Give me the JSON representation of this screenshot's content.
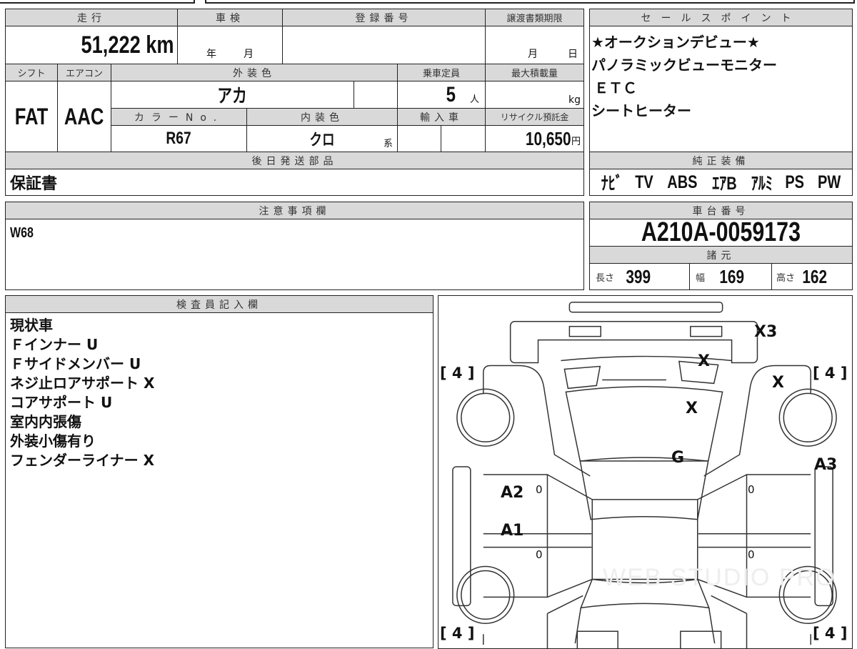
{
  "main": {
    "mileage_label": "走行",
    "mileage": "51,222 km",
    "shaken_label": "車検",
    "shaken_year": "年",
    "shaken_month": "月",
    "reg_label": "登録番号",
    "transfer_label": "譲渡書類期限",
    "transfer_month": "月",
    "transfer_day": "日",
    "shift_label": "シフト",
    "shift": "FAT",
    "ac_label": "エアコン",
    "ac": "AAC",
    "ext_color_label": "外装色",
    "ext_color": "アカ",
    "capacity_label": "乗車定員",
    "capacity": "5",
    "capacity_unit": "人",
    "max_load_label": "最大積載量",
    "max_load_unit": "kg",
    "color_no_label": "カラーNo.",
    "color_no": "R67",
    "int_color_label": "内装色",
    "int_color": "クロ",
    "int_color_suffix": "系",
    "import_label": "輸入車",
    "recycle_label": "リサイクル預託金",
    "recycle": "10,650",
    "recycle_unit": "円",
    "later_parts_label": "後日発送部品",
    "later_parts": "保証書"
  },
  "sales": {
    "label": "セールスポイント",
    "items": [
      "★オークションデビュー★",
      "パノラミックビューモニター",
      "ＥＴＣ",
      "シートヒーター"
    ]
  },
  "equipment": {
    "label": "純正装備",
    "items": [
      "ﾅﾋﾞ",
      "TV",
      "ABS",
      "ｴｱB",
      "ｱﾙﾐ",
      "PS",
      "PW"
    ]
  },
  "notes": {
    "label": "注意事項欄",
    "text": "W68"
  },
  "chassis": {
    "label": "車台番号",
    "number": "A210A-0059173",
    "spec_label": "諸元",
    "length_label": "長さ",
    "length": "399",
    "width_label": "幅",
    "width": "169",
    "height_label": "高さ",
    "height": "162"
  },
  "inspector": {
    "label": "検査員記入欄",
    "lines": [
      "現状車",
      "Ｆインナー U",
      "Ｆサイドメンバー U",
      "ネジ止ロアサポート X",
      "コアサポート U",
      "室内内張傷",
      "外装小傷有り",
      "フェンダーライナー X"
    ]
  },
  "diagram": {
    "marks": [
      "X3",
      "X",
      "X",
      "X",
      "G",
      "A2",
      "A1",
      "A3",
      "0",
      "0",
      "0",
      "0"
    ],
    "tires": [
      "[ 4 ]",
      "[ 4 ]",
      "[ 4 ]",
      "[ 4 ]"
    ],
    "watermark": "WEB STUDIO PRO"
  }
}
